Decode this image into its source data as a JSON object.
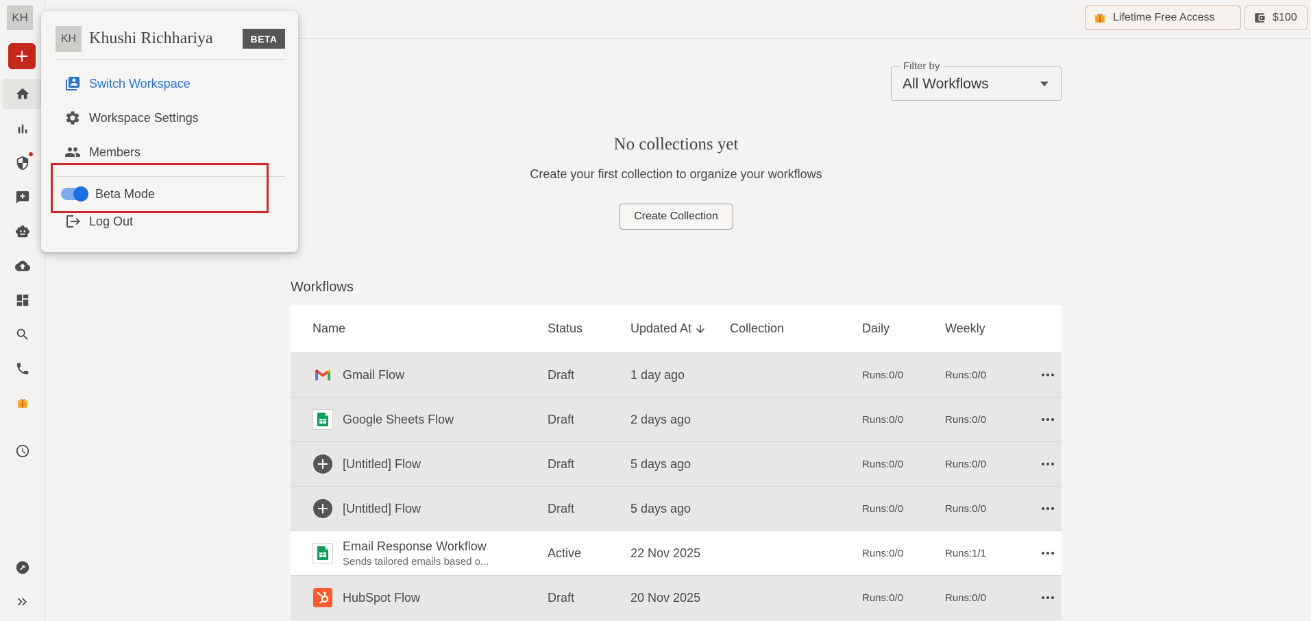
{
  "rail": {
    "avatar_initials": "KH",
    "items": [
      "home-icon",
      "analytics-icon",
      "shield-icon",
      "feedback-icon",
      "robot-icon",
      "cloud-upload-icon",
      "dashboard-icon",
      "search-icon",
      "phone-icon",
      "gift-icon",
      "history-icon",
      "wrench-icon",
      "expand-icon"
    ]
  },
  "topbar": {
    "lifetime_label": "Lifetime Free Access",
    "wallet_label": "$100"
  },
  "filter": {
    "label": "Filter by",
    "value": "All Workflows"
  },
  "empty_state": {
    "title": "No collections yet",
    "subtitle": "Create your first collection to organize your workflows",
    "button_label": "Create Collection"
  },
  "workflows": {
    "title": "Workflows",
    "columns": {
      "name": "Name",
      "status": "Status",
      "updated": "Updated At",
      "collection": "Collection",
      "daily": "Daily",
      "weekly": "Weekly"
    },
    "rows": [
      {
        "name": "Gmail Flow",
        "sub": "",
        "status": "Draft",
        "updated": "1 day ago",
        "collection": "",
        "daily": "Runs:0/0",
        "weekly": "Runs:0/0",
        "icon": "gmail-icon"
      },
      {
        "name": "Google Sheets Flow",
        "sub": "",
        "status": "Draft",
        "updated": "2 days ago",
        "collection": "",
        "daily": "Runs:0/0",
        "weekly": "Runs:0/0",
        "icon": "google-sheets-icon"
      },
      {
        "name": "[Untitled] Flow",
        "sub": "",
        "status": "Draft",
        "updated": "5 days ago",
        "collection": "",
        "daily": "Runs:0/0",
        "weekly": "Runs:0/0",
        "icon": "add-circle-icon"
      },
      {
        "name": "[Untitled] Flow",
        "sub": "",
        "status": "Draft",
        "updated": "5 days ago",
        "collection": "",
        "daily": "Runs:0/0",
        "weekly": "Runs:0/0",
        "icon": "add-circle-icon"
      },
      {
        "name": "Email Response Workflow",
        "sub": "Sends tailored emails based o...",
        "status": "Active",
        "updated": "22 Nov 2025",
        "collection": "",
        "daily": "Runs:0/0",
        "weekly": "Runs:1/1",
        "icon": "google-sheets-icon"
      },
      {
        "name": "HubSpot Flow",
        "sub": "",
        "status": "Draft",
        "updated": "20 Nov 2025",
        "collection": "",
        "daily": "Runs:0/0",
        "weekly": "Runs:0/0",
        "icon": "hubspot-icon"
      }
    ]
  },
  "menu": {
    "avatar_initials": "KH",
    "user_name": "Khushi Richhariya",
    "badge": "BETA",
    "switch_workspace": "Switch Workspace",
    "workspace_settings": "Workspace Settings",
    "members": "Members",
    "beta_mode": "Beta Mode",
    "log_out": "Log Out"
  },
  "colors": {
    "accent_red": "#c4271c",
    "link_blue": "#2a73c9",
    "toggle_blue": "#1f6fe0",
    "highlight_red": "#d0262a"
  }
}
